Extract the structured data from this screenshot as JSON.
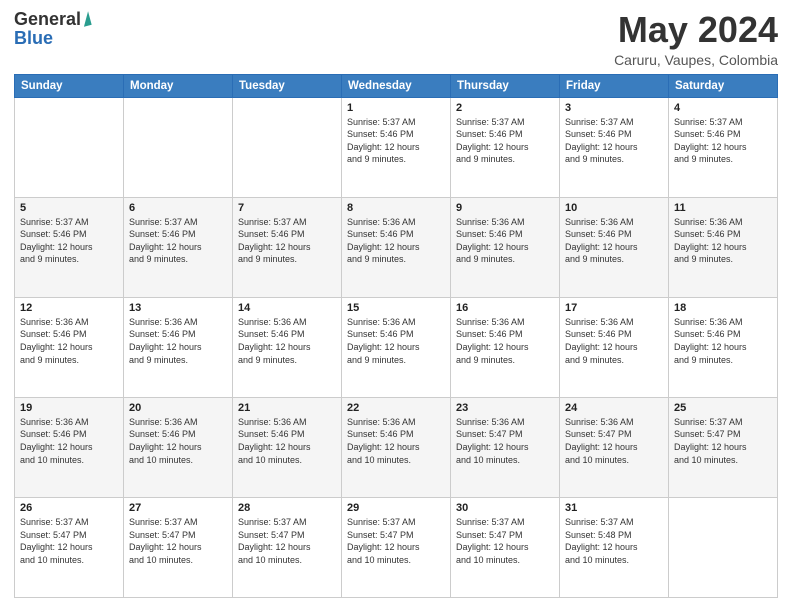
{
  "logo": {
    "general": "General",
    "blue": "Blue"
  },
  "title": {
    "main": "May 2024",
    "sub": "Caruru, Vaupes, Colombia"
  },
  "calendar": {
    "headers": [
      "Sunday",
      "Monday",
      "Tuesday",
      "Wednesday",
      "Thursday",
      "Friday",
      "Saturday"
    ],
    "weeks": [
      [
        {
          "day": "",
          "info": ""
        },
        {
          "day": "",
          "info": ""
        },
        {
          "day": "",
          "info": ""
        },
        {
          "day": "1",
          "info": "Sunrise: 5:37 AM\nSunset: 5:46 PM\nDaylight: 12 hours\nand 9 minutes."
        },
        {
          "day": "2",
          "info": "Sunrise: 5:37 AM\nSunset: 5:46 PM\nDaylight: 12 hours\nand 9 minutes."
        },
        {
          "day": "3",
          "info": "Sunrise: 5:37 AM\nSunset: 5:46 PM\nDaylight: 12 hours\nand 9 minutes."
        },
        {
          "day": "4",
          "info": "Sunrise: 5:37 AM\nSunset: 5:46 PM\nDaylight: 12 hours\nand 9 minutes."
        }
      ],
      [
        {
          "day": "5",
          "info": "Sunrise: 5:37 AM\nSunset: 5:46 PM\nDaylight: 12 hours\nand 9 minutes."
        },
        {
          "day": "6",
          "info": "Sunrise: 5:37 AM\nSunset: 5:46 PM\nDaylight: 12 hours\nand 9 minutes."
        },
        {
          "day": "7",
          "info": "Sunrise: 5:37 AM\nSunset: 5:46 PM\nDaylight: 12 hours\nand 9 minutes."
        },
        {
          "day": "8",
          "info": "Sunrise: 5:36 AM\nSunset: 5:46 PM\nDaylight: 12 hours\nand 9 minutes."
        },
        {
          "day": "9",
          "info": "Sunrise: 5:36 AM\nSunset: 5:46 PM\nDaylight: 12 hours\nand 9 minutes."
        },
        {
          "day": "10",
          "info": "Sunrise: 5:36 AM\nSunset: 5:46 PM\nDaylight: 12 hours\nand 9 minutes."
        },
        {
          "day": "11",
          "info": "Sunrise: 5:36 AM\nSunset: 5:46 PM\nDaylight: 12 hours\nand 9 minutes."
        }
      ],
      [
        {
          "day": "12",
          "info": "Sunrise: 5:36 AM\nSunset: 5:46 PM\nDaylight: 12 hours\nand 9 minutes."
        },
        {
          "day": "13",
          "info": "Sunrise: 5:36 AM\nSunset: 5:46 PM\nDaylight: 12 hours\nand 9 minutes."
        },
        {
          "day": "14",
          "info": "Sunrise: 5:36 AM\nSunset: 5:46 PM\nDaylight: 12 hours\nand 9 minutes."
        },
        {
          "day": "15",
          "info": "Sunrise: 5:36 AM\nSunset: 5:46 PM\nDaylight: 12 hours\nand 9 minutes."
        },
        {
          "day": "16",
          "info": "Sunrise: 5:36 AM\nSunset: 5:46 PM\nDaylight: 12 hours\nand 9 minutes."
        },
        {
          "day": "17",
          "info": "Sunrise: 5:36 AM\nSunset: 5:46 PM\nDaylight: 12 hours\nand 9 minutes."
        },
        {
          "day": "18",
          "info": "Sunrise: 5:36 AM\nSunset: 5:46 PM\nDaylight: 12 hours\nand 9 minutes."
        }
      ],
      [
        {
          "day": "19",
          "info": "Sunrise: 5:36 AM\nSunset: 5:46 PM\nDaylight: 12 hours\nand 10 minutes."
        },
        {
          "day": "20",
          "info": "Sunrise: 5:36 AM\nSunset: 5:46 PM\nDaylight: 12 hours\nand 10 minutes."
        },
        {
          "day": "21",
          "info": "Sunrise: 5:36 AM\nSunset: 5:46 PM\nDaylight: 12 hours\nand 10 minutes."
        },
        {
          "day": "22",
          "info": "Sunrise: 5:36 AM\nSunset: 5:46 PM\nDaylight: 12 hours\nand 10 minutes."
        },
        {
          "day": "23",
          "info": "Sunrise: 5:36 AM\nSunset: 5:47 PM\nDaylight: 12 hours\nand 10 minutes."
        },
        {
          "day": "24",
          "info": "Sunrise: 5:36 AM\nSunset: 5:47 PM\nDaylight: 12 hours\nand 10 minutes."
        },
        {
          "day": "25",
          "info": "Sunrise: 5:37 AM\nSunset: 5:47 PM\nDaylight: 12 hours\nand 10 minutes."
        }
      ],
      [
        {
          "day": "26",
          "info": "Sunrise: 5:37 AM\nSunset: 5:47 PM\nDaylight: 12 hours\nand 10 minutes."
        },
        {
          "day": "27",
          "info": "Sunrise: 5:37 AM\nSunset: 5:47 PM\nDaylight: 12 hours\nand 10 minutes."
        },
        {
          "day": "28",
          "info": "Sunrise: 5:37 AM\nSunset: 5:47 PM\nDaylight: 12 hours\nand 10 minutes."
        },
        {
          "day": "29",
          "info": "Sunrise: 5:37 AM\nSunset: 5:47 PM\nDaylight: 12 hours\nand 10 minutes."
        },
        {
          "day": "30",
          "info": "Sunrise: 5:37 AM\nSunset: 5:47 PM\nDaylight: 12 hours\nand 10 minutes."
        },
        {
          "day": "31",
          "info": "Sunrise: 5:37 AM\nSunset: 5:48 PM\nDaylight: 12 hours\nand 10 minutes."
        },
        {
          "day": "",
          "info": ""
        }
      ]
    ]
  }
}
